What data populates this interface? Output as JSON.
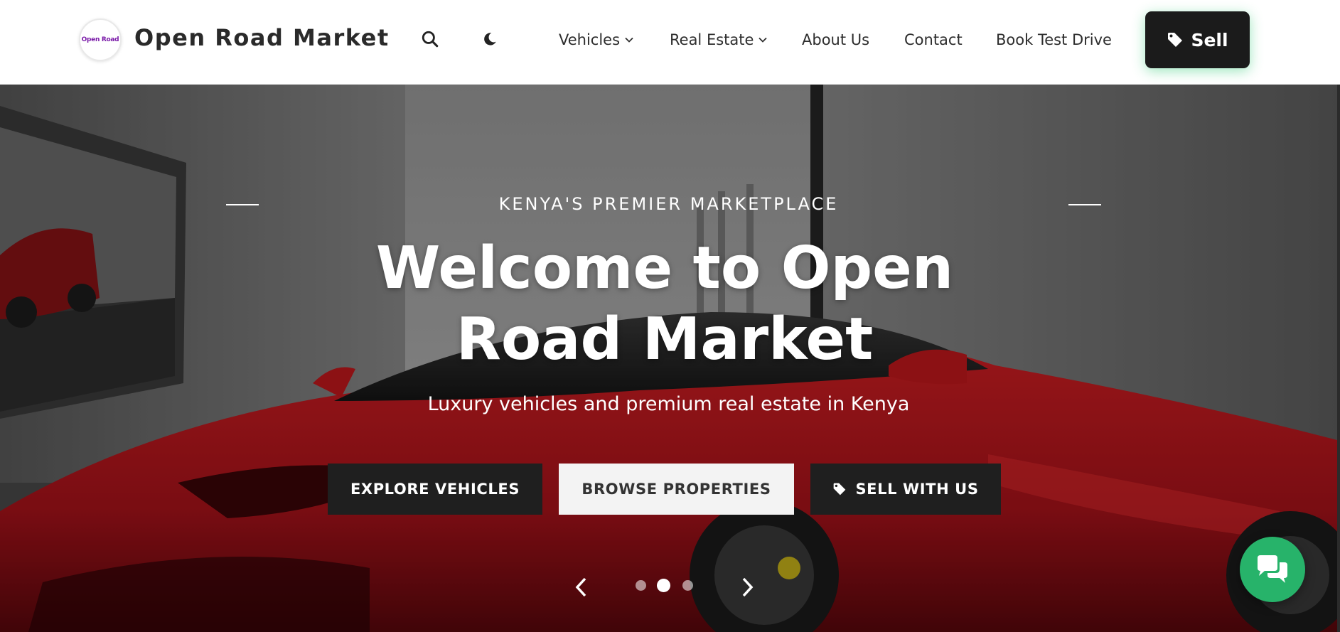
{
  "brand": {
    "name": "Open Road Market",
    "logo_text": "Open Road",
    "logo_color": "#7a1aa8"
  },
  "header": {
    "search_icon": "search-icon",
    "theme_icon": "moon-icon",
    "nav": [
      {
        "label": "Vehicles",
        "has_dropdown": true
      },
      {
        "label": "Real Estate",
        "has_dropdown": true
      },
      {
        "label": "About Us",
        "has_dropdown": false
      },
      {
        "label": "Contact",
        "has_dropdown": false
      },
      {
        "label": "Book Test Drive",
        "has_dropdown": false
      }
    ],
    "sell_label": "Sell",
    "sell_icon": "tag-icon"
  },
  "hero": {
    "eyebrow": "KENYA'S PREMIER MARKETPLACE",
    "title": "Welcome to Open Road Market",
    "subtitle": "Luxury vehicles and premium real estate in Kenya",
    "buttons": {
      "explore": "EXPLORE VEHICLES",
      "browse": "BROWSE PROPERTIES",
      "sell": "SELL WITH US"
    },
    "carousel": {
      "slide_count": 3,
      "active_slide": 2
    }
  },
  "colors": {
    "dark_button": "#1f1f1f",
    "light_button": "#f3f3f3",
    "chat_green": "#27b36a",
    "car_red": "#c0161a"
  },
  "chat": {
    "icon": "chat-bubbles-icon"
  }
}
